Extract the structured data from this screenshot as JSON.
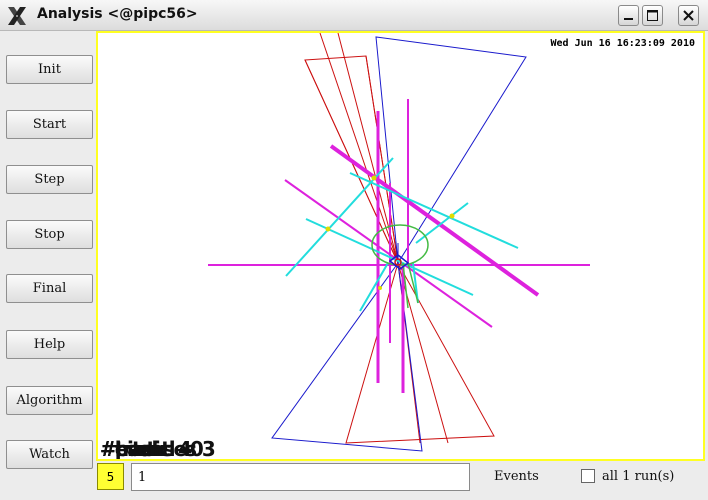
{
  "window": {
    "title": "Analysis <@pipc56>",
    "buttons": [
      "minimize-icon",
      "maximize-icon",
      "close-icon"
    ]
  },
  "sidebar": {
    "buttons": [
      "Init",
      "Start",
      "Step",
      "Stop",
      "Final",
      "Help",
      "Algorithm",
      "Watch"
    ]
  },
  "canvas": {
    "timestamp": "Wed Jun 16 16:23:09 2010",
    "overlay_labels": [
      "#particles",
      "#tracks",
      "#hits",
      "#event"
    ],
    "overlay_fragment": "403",
    "colors": {
      "border": "#ffff22",
      "background": "#ffffff",
      "red": "#cc1111",
      "blue": "#1a1acc",
      "magenta": "#dd22dd",
      "cyan": "#22dddd",
      "green": "#44bb44"
    }
  },
  "controls": {
    "event_count": "5",
    "event_count_color": "#ffff33",
    "event_input_value": "1",
    "events_label": "Events",
    "all_runs_label": "all 1 run(s)",
    "all_runs_checked": false
  }
}
